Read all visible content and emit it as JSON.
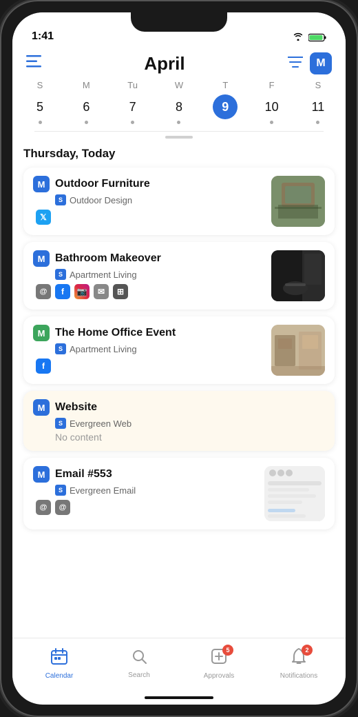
{
  "status": {
    "time": "1:41",
    "wifi": "wifi",
    "battery": "battery"
  },
  "header": {
    "title": "April",
    "menu_icon": "☰",
    "filter_icon": "filter",
    "m_badge": "M"
  },
  "calendar": {
    "weekdays": [
      "S",
      "M",
      "Tu",
      "W",
      "T",
      "F",
      "S"
    ],
    "dates": [
      {
        "num": "5",
        "today": false,
        "dot": true
      },
      {
        "num": "6",
        "today": false,
        "dot": true
      },
      {
        "num": "7",
        "today": false,
        "dot": true
      },
      {
        "num": "8",
        "today": false,
        "dot": true
      },
      {
        "num": "9",
        "today": true,
        "dot": false
      },
      {
        "num": "10",
        "today": false,
        "dot": true
      },
      {
        "num": "11",
        "today": false,
        "dot": true
      }
    ]
  },
  "section_label": "Thursday, Today",
  "events": [
    {
      "id": "outdoor-furniture",
      "title": "Outdoor Furniture",
      "source": "Outdoor Design",
      "highlighted": false,
      "has_thumb": true,
      "thumb_type": "outdoor",
      "social": [
        "twitter"
      ],
      "no_content": false
    },
    {
      "id": "bathroom-makeover",
      "title": "Bathroom Makeover",
      "source": "Apartment Living",
      "highlighted": false,
      "has_thumb": true,
      "thumb_type": "bathroom",
      "social": [
        "at",
        "facebook",
        "instagram",
        "email",
        "grid"
      ],
      "no_content": false
    },
    {
      "id": "home-office",
      "title": "The Home Office Event",
      "source": "Apartment Living",
      "highlighted": false,
      "has_thumb": true,
      "thumb_type": "office",
      "social": [
        "facebook"
      ],
      "no_content": false
    },
    {
      "id": "website",
      "title": "Website",
      "source": "Evergreen Web",
      "highlighted": true,
      "has_thumb": false,
      "thumb_type": null,
      "social": [],
      "no_content": true,
      "no_content_text": "No content"
    },
    {
      "id": "email-553",
      "title": "Email #553",
      "source": "Evergreen Email",
      "highlighted": false,
      "has_thumb": true,
      "thumb_type": "email",
      "social": [
        "at",
        "at"
      ],
      "no_content": false
    }
  ],
  "bottom_nav": {
    "items": [
      {
        "id": "calendar",
        "label": "Calendar",
        "icon": "calendar",
        "active": true,
        "badge": null
      },
      {
        "id": "search",
        "label": "Search",
        "icon": "search",
        "active": false,
        "badge": null
      },
      {
        "id": "approvals",
        "label": "Approvals",
        "icon": "approvals",
        "active": false,
        "badge": "5"
      },
      {
        "id": "notifications",
        "label": "Notifications",
        "icon": "bell",
        "active": false,
        "badge": "2"
      }
    ]
  }
}
